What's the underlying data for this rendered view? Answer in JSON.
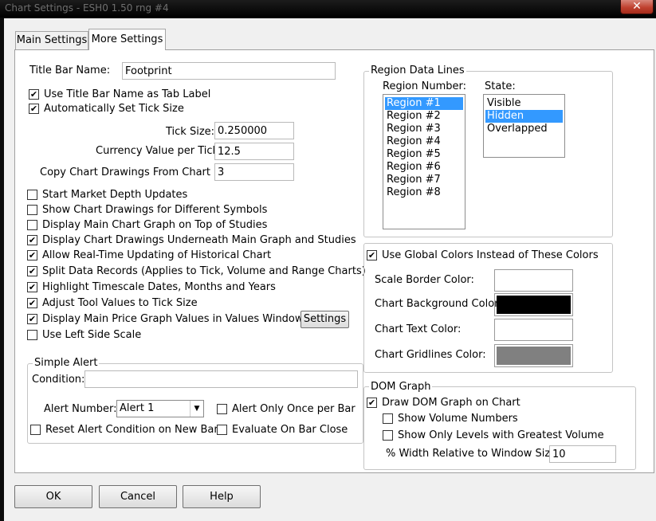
{
  "window": {
    "title": "Chart Settings - ESH0  1.50 rng  #4"
  },
  "tabs": [
    "Main Settings",
    "More Settings"
  ],
  "title_bar": {
    "label": "Title Bar Name:",
    "value": "Footprint"
  },
  "checks_top": [
    {
      "label": "Use Title Bar Name as Tab Label",
      "checked": true
    },
    {
      "label": "Automatically Set Tick Size",
      "checked": true
    }
  ],
  "fields": [
    {
      "label": "Tick Size:",
      "value": "0.250000"
    },
    {
      "label": "Currency Value per Tick:",
      "value": "12.5"
    },
    {
      "label": "Copy Chart Drawings From Chart #'s:",
      "value": "3"
    }
  ],
  "options": [
    {
      "label": "Start Market Depth Updates",
      "checked": false
    },
    {
      "label": "Show Chart Drawings for Different Symbols",
      "checked": false
    },
    {
      "label": "Display Main Chart Graph on Top of Studies",
      "checked": false
    },
    {
      "label": "Display Chart Drawings Underneath Main Graph and Studies",
      "checked": true
    },
    {
      "label": "Allow Real-Time Updating of Historical Chart",
      "checked": true
    },
    {
      "label": "Split Data Records (Applies to Tick, Volume and Range Charts)",
      "checked": true
    },
    {
      "label": "Highlight Timescale Dates, Months and Years",
      "checked": true
    },
    {
      "label": "Adjust Tool Values to Tick Size",
      "checked": true
    },
    {
      "label": "Display Main Price Graph Values in Values Windows",
      "checked": true
    },
    {
      "label": "Use Left Side Scale",
      "checked": false
    }
  ],
  "settings_button": "Settings",
  "simple_alert": {
    "title": "Simple Alert",
    "condition_label": "Condition:",
    "condition_value": "",
    "alert_number_label": "Alert Number:",
    "alert_number_value": "Alert 1",
    "alert_once": {
      "label": "Alert Only Once per Bar",
      "checked": false
    },
    "reset": {
      "label": "Reset Alert Condition on New Bar",
      "checked": false
    },
    "evaluate": {
      "label": "Evaluate On Bar Close",
      "checked": false
    }
  },
  "region": {
    "title": "Region Data Lines",
    "number_label": "Region Number:",
    "state_label": "State:",
    "regions": [
      "Region #1",
      "Region #2",
      "Region #3",
      "Region #4",
      "Region #5",
      "Region #6",
      "Region #7",
      "Region #8"
    ],
    "selected_region": 0,
    "states": [
      "Visible",
      "Hidden",
      "Overlapped"
    ],
    "selected_state": 1
  },
  "colors": {
    "global": {
      "label": "Use Global Colors Instead of These Colors",
      "checked": true
    },
    "items": [
      {
        "label": "Scale Border Color:",
        "color": "#ffffff"
      },
      {
        "label": "Chart Background Color:",
        "color": "#000000"
      },
      {
        "label": "Chart Text Color:",
        "color": "#ffffff"
      },
      {
        "label": "Chart Gridlines Color:",
        "color": "#808080"
      }
    ]
  },
  "dom": {
    "title": "DOM Graph",
    "draw": {
      "label": "Draw DOM Graph on Chart",
      "checked": true
    },
    "volume": {
      "label": "Show Volume Numbers",
      "checked": false
    },
    "greatest": {
      "label": "Show Only Levels with Greatest Volume",
      "checked": false
    },
    "width_label": "% Width Relative to Window Size:",
    "width_value": "10"
  },
  "buttons": {
    "ok": "OK",
    "cancel": "Cancel",
    "help": "Help"
  }
}
